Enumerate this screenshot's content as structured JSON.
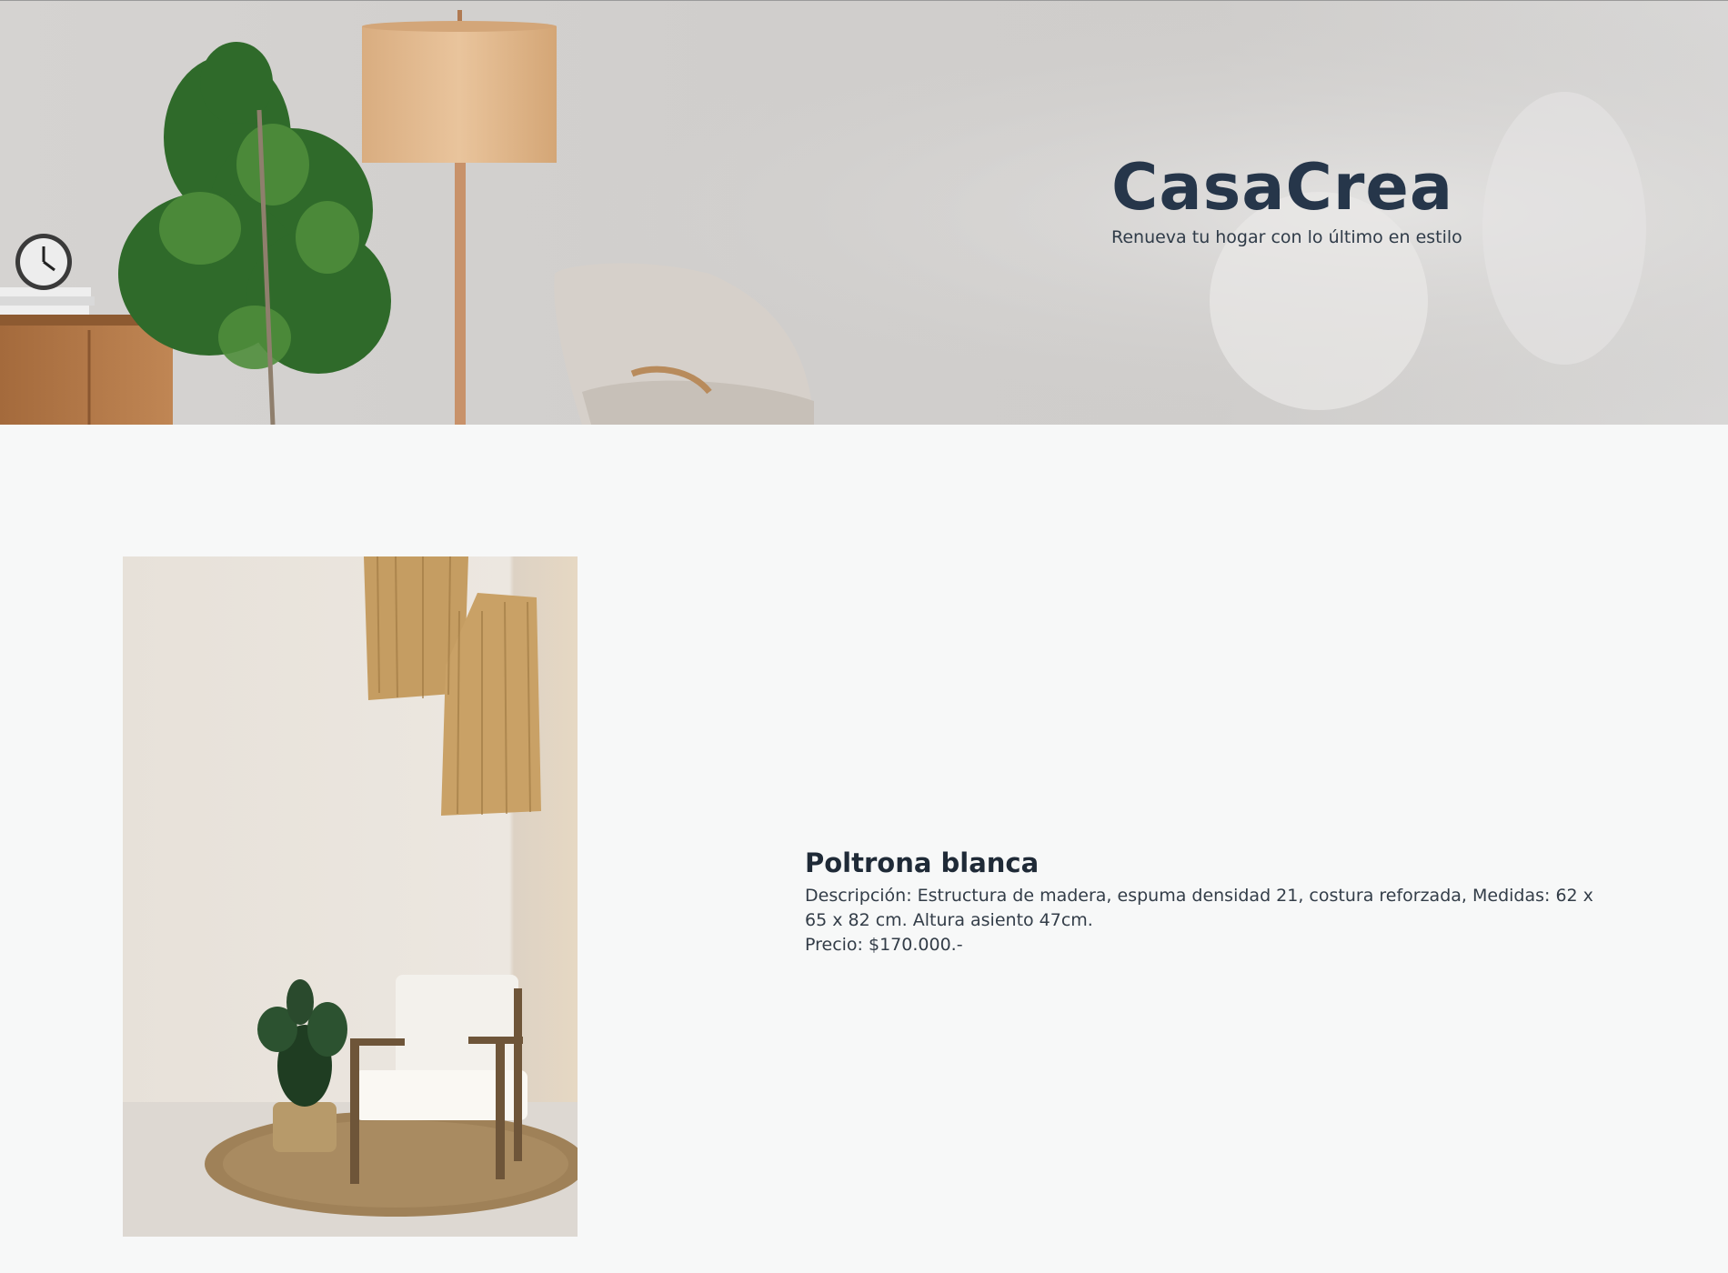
{
  "hero": {
    "title": "CasaCrea",
    "tagline": "Renueva tu hogar con lo último en estilo"
  },
  "product": {
    "name": "Poltrona blanca",
    "description": "Descripción: Estructura de madera, espuma densidad 21, costura reforzada, Medidas: 62 x 65 x 82 cm. Altura asiento 47cm.",
    "price": "Precio: $170.000.-"
  },
  "colors": {
    "title": "#26364a",
    "text": "#333d48",
    "background": "#f7f8f8"
  }
}
